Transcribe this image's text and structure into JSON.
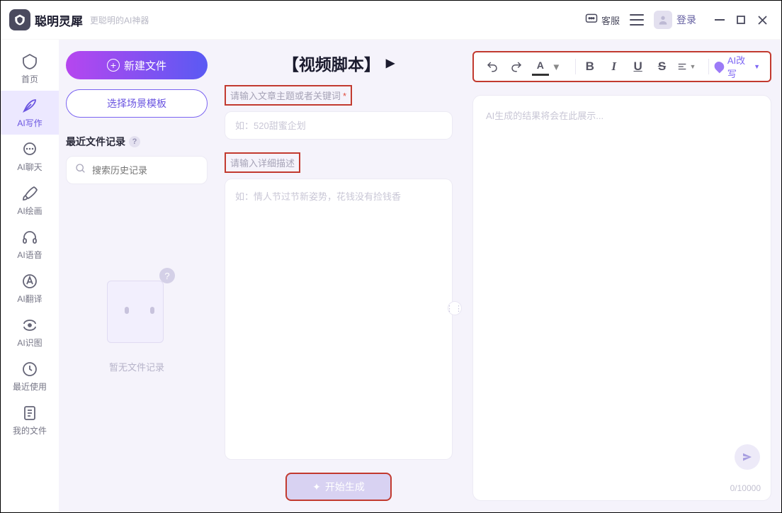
{
  "header": {
    "app_name": "聪明灵犀",
    "subtitle": "更聪明的AI神器",
    "service": "客服",
    "login": "登录"
  },
  "sidebar": {
    "items": [
      {
        "label": "首页",
        "icon": "home"
      },
      {
        "label": "AI写作",
        "icon": "feather"
      },
      {
        "label": "AI聊天",
        "icon": "chat"
      },
      {
        "label": "AI绘画",
        "icon": "brush"
      },
      {
        "label": "AI语音",
        "icon": "headphone"
      },
      {
        "label": "AI翻译",
        "icon": "translate"
      },
      {
        "label": "AI识图",
        "icon": "vision"
      },
      {
        "label": "最近使用",
        "icon": "recent"
      },
      {
        "label": "我的文件",
        "icon": "file"
      }
    ]
  },
  "leftcol": {
    "new_file": "新建文件",
    "template": "选择场景模板",
    "recent_label": "最近文件记录",
    "search_placeholder": "搜索历史记录",
    "empty_text": "暂无文件记录"
  },
  "center": {
    "title": "【视频脚本】",
    "keyword_label": "请输入文章主题或者关键词",
    "keyword_placeholder": "如：520甜蜜企划",
    "desc_label": "请输入详细描述",
    "desc_placeholder": "如：情人节过节新姿势，花钱没有捡钱香",
    "generate": "开始生成"
  },
  "right": {
    "tools": {
      "text_color": "A",
      "bold": "B",
      "italic": "I",
      "underline": "U",
      "strike": "S"
    },
    "rewrite": "AI改写",
    "output_placeholder": "AI生成的结果将会在此展示...",
    "counter": "0/10000"
  }
}
